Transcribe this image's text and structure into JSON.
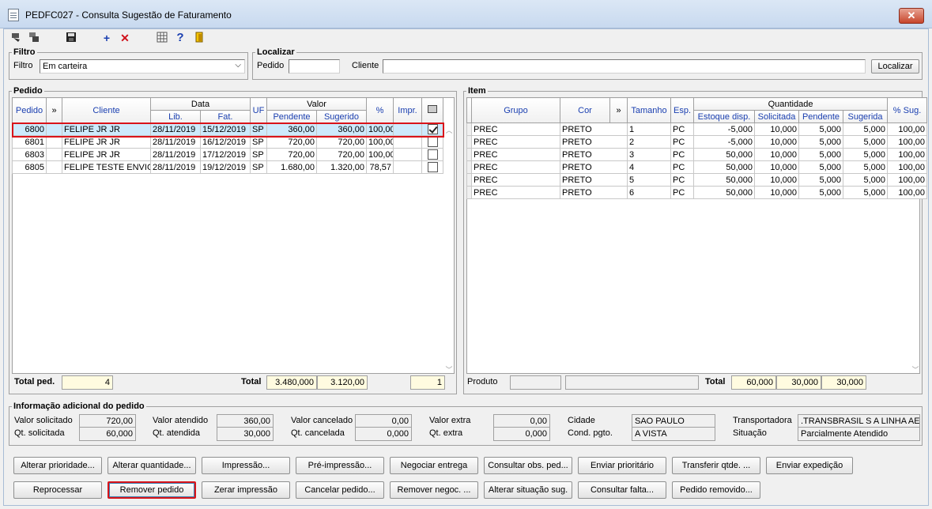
{
  "window": {
    "title": "PEDFC027 - Consulta Sugestão de Faturamento",
    "close": "✕"
  },
  "toolbar": {
    "icons": [
      "back-icon",
      "forward-icon",
      "save-icon",
      "add-icon",
      "delete-icon",
      "calculator-icon",
      "help-icon",
      "exit-icon"
    ],
    "add_glyph": "+",
    "delete_glyph": "✕",
    "help_glyph": "?"
  },
  "filtro": {
    "legend": "Filtro",
    "label": "Filtro",
    "value": "Em carteira"
  },
  "localizar": {
    "legend": "Localizar",
    "pedido_label": "Pedido",
    "pedido_value": "",
    "cliente_label": "Cliente",
    "cliente_value": "",
    "button": "Localizar"
  },
  "pedido": {
    "legend": "Pedido",
    "headers": {
      "pedido": "Pedido",
      "more": "»",
      "cliente": "Cliente",
      "data": "Data",
      "lib": "Lib.",
      "fat": "Fat.",
      "uf": "UF",
      "valor": "Valor",
      "pendente": "Pendente",
      "sugerido": "Sugerido",
      "pct": "%",
      "impr": "Impr."
    },
    "rows": [
      {
        "pedido": "6800",
        "cliente": "FELIPE JR JR",
        "lib": "28/11/2019",
        "fat": "15/12/2019",
        "uf": "SP",
        "pendente": "360,00",
        "sugerido": "360,00",
        "pct": "100,00",
        "checked": true
      },
      {
        "pedido": "6801",
        "cliente": "FELIPE JR JR",
        "lib": "28/11/2019",
        "fat": "16/12/2019",
        "uf": "SP",
        "pendente": "720,00",
        "sugerido": "720,00",
        "pct": "100,00",
        "checked": false
      },
      {
        "pedido": "6803",
        "cliente": "FELIPE JR JR",
        "lib": "28/11/2019",
        "fat": "17/12/2019",
        "uf": "SP",
        "pendente": "720,00",
        "sugerido": "720,00",
        "pct": "100,00",
        "checked": false
      },
      {
        "pedido": "6805",
        "cliente": "FELIPE TESTE ENVIO C",
        "lib": "28/11/2019",
        "fat": "19/12/2019",
        "uf": "SP",
        "pendente": "1.680,00",
        "sugerido": "1.320,00",
        "pct": "78,57",
        "checked": false
      }
    ],
    "total_ped_label": "Total ped.",
    "total_ped": "4",
    "total_label": "Total",
    "total_pendente": "3.480,000",
    "total_sugerido": "3.120,00",
    "total_check": "1"
  },
  "item": {
    "legend": "Item",
    "headers": {
      "grupo": "Grupo",
      "cor": "Cor",
      "more": "»",
      "tamanho": "Tamanho",
      "esp": "Esp.",
      "quantidade": "Quantidade",
      "estoque": "Estoque disp.",
      "solicitada": "Solicitada",
      "pendente": "Pendente",
      "sugerida": "Sugerida",
      "pct_sug": "% Sug."
    },
    "rows": [
      {
        "grupo": "PREC",
        "cor": "PRETO",
        "tamanho": "1",
        "esp": "PC",
        "estoque": "-5,000",
        "solicitada": "10,000",
        "pendente": "5,000",
        "sugerida": "5,000",
        "pct": "100,00"
      },
      {
        "grupo": "PREC",
        "cor": "PRETO",
        "tamanho": "2",
        "esp": "PC",
        "estoque": "-5,000",
        "solicitada": "10,000",
        "pendente": "5,000",
        "sugerida": "5,000",
        "pct": "100,00"
      },
      {
        "grupo": "PREC",
        "cor": "PRETO",
        "tamanho": "3",
        "esp": "PC",
        "estoque": "50,000",
        "solicitada": "10,000",
        "pendente": "5,000",
        "sugerida": "5,000",
        "pct": "100,00"
      },
      {
        "grupo": "PREC",
        "cor": "PRETO",
        "tamanho": "4",
        "esp": "PC",
        "estoque": "50,000",
        "solicitada": "10,000",
        "pendente": "5,000",
        "sugerida": "5,000",
        "pct": "100,00"
      },
      {
        "grupo": "PREC",
        "cor": "PRETO",
        "tamanho": "5",
        "esp": "PC",
        "estoque": "50,000",
        "solicitada": "10,000",
        "pendente": "5,000",
        "sugerida": "5,000",
        "pct": "100,00"
      },
      {
        "grupo": "PREC",
        "cor": "PRETO",
        "tamanho": "6",
        "esp": "PC",
        "estoque": "50,000",
        "solicitada": "10,000",
        "pendente": "5,000",
        "sugerida": "5,000",
        "pct": "100,00"
      }
    ],
    "produto_label": "Produto",
    "produto_code": "",
    "produto_desc": "",
    "total_label": "Total",
    "total_solicitada": "60,000",
    "total_pendente": "30,000",
    "total_sugerida": "30,000"
  },
  "info": {
    "legend": "Informação adicional do pedido",
    "valor_solicitado_label": "Valor solicitado",
    "valor_solicitado": "720,00",
    "qt_solicitada_label": "Qt. solicitada",
    "qt_solicitada": "60,000",
    "valor_atendido_label": "Valor atendido",
    "valor_atendido": "360,00",
    "qt_atendida_label": "Qt. atendida",
    "qt_atendida": "30,000",
    "valor_cancelado_label": "Valor cancelado",
    "valor_cancelado": "0,00",
    "qt_cancelada_label": "Qt. cancelada",
    "qt_cancelada": "0,000",
    "valor_extra_label": "Valor extra",
    "valor_extra": "0,00",
    "qt_extra_label": "Qt. extra",
    "qt_extra": "0,000",
    "cidade_label": "Cidade",
    "cidade": "SAO PAULO",
    "cond_label": "Cond. pgto.",
    "cond": "A VISTA",
    "transportadora_label": "Transportadora",
    "transportadora": ".TRANSBRASIL S A LINHA AERI",
    "situacao_label": "Situação",
    "situacao": "Parcialmente Atendido"
  },
  "buttons_row1": [
    "Alterar prioridade...",
    "Alterar quantidade...",
    "Impressão...",
    "Pré-impressão...",
    "Negociar entrega",
    "Consultar obs. ped...",
    "Enviar prioritário",
    "Transferir qtde. ...",
    "Enviar expedição"
  ],
  "buttons_row2": [
    "Reprocessar",
    "Remover pedido",
    "Zerar impressão",
    "Cancelar pedido...",
    "Remover negoc. ...",
    "Alterar situação sug.",
    "Consultar falta...",
    "Pedido removido..."
  ]
}
